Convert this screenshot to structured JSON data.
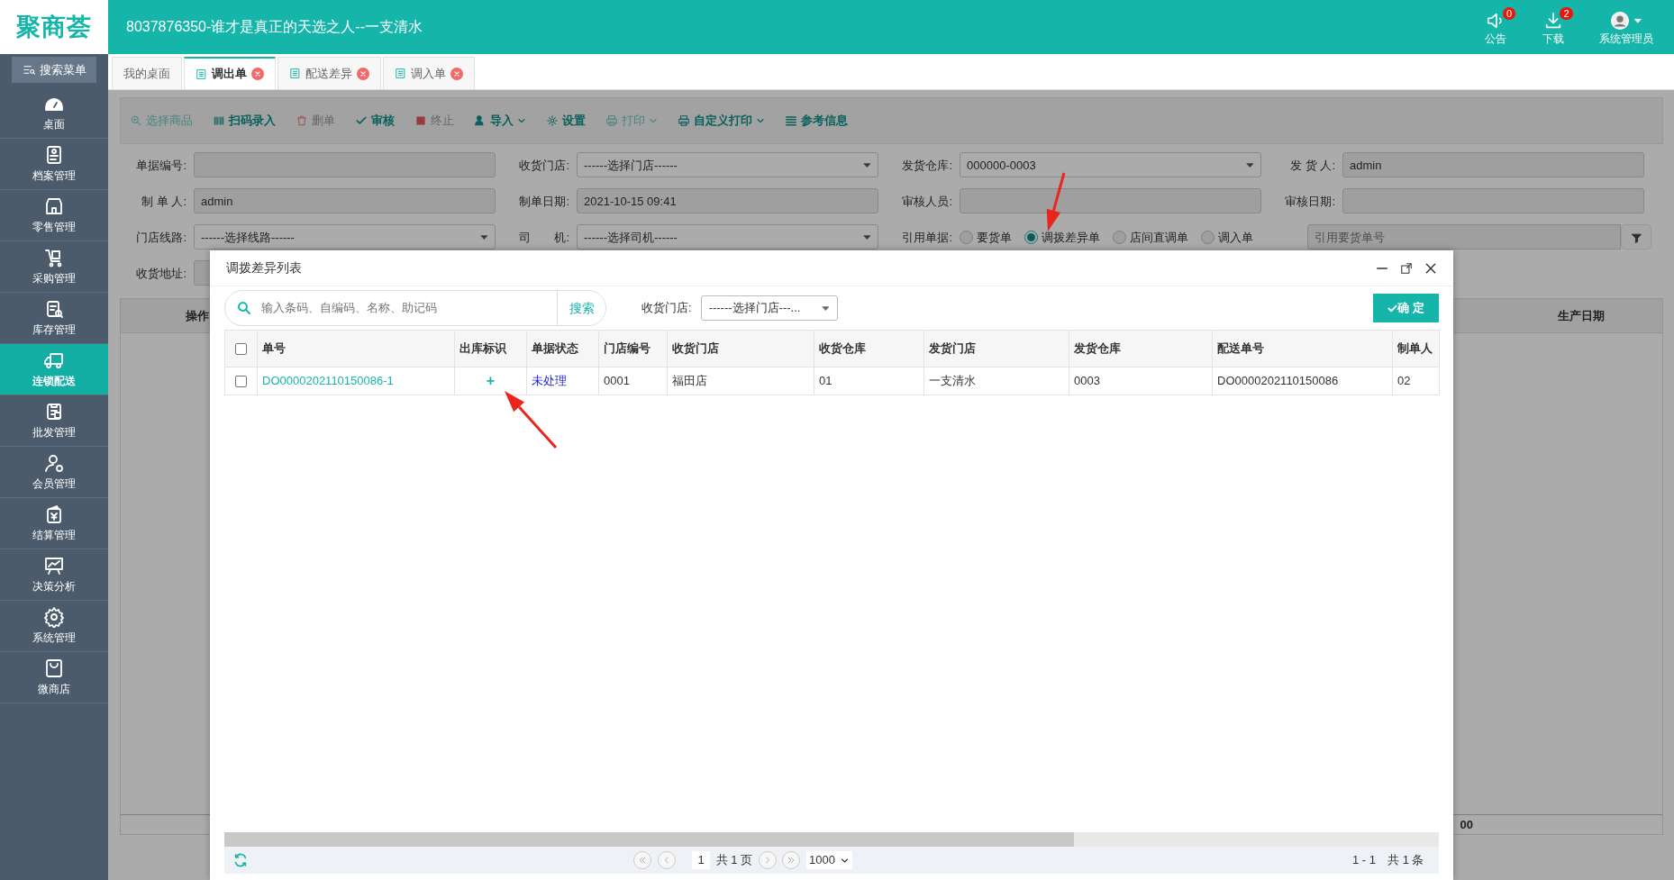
{
  "app": {
    "logo": "聚商荟",
    "title": "8037876350-谁才是真正的天选之人--一支清水"
  },
  "header_actions": [
    {
      "label": "公告",
      "badge": "0"
    },
    {
      "label": "下载",
      "badge": "2"
    },
    {
      "label": "系统管理员"
    }
  ],
  "sidebar": {
    "search_button": "搜索菜单",
    "items": [
      {
        "label": "桌面",
        "selected": false
      },
      {
        "label": "档案管理",
        "selected": false
      },
      {
        "label": "零售管理",
        "selected": false
      },
      {
        "label": "采购管理",
        "selected": false
      },
      {
        "label": "库存管理",
        "selected": false
      },
      {
        "label": "连锁配送",
        "selected": true
      },
      {
        "label": "批发管理",
        "selected": false
      },
      {
        "label": "会员管理",
        "selected": false
      },
      {
        "label": "结算管理",
        "selected": false
      },
      {
        "label": "决策分析",
        "selected": false
      },
      {
        "label": "系统管理",
        "selected": false
      },
      {
        "label": "微商店",
        "selected": false
      }
    ]
  },
  "tabs": [
    {
      "label": "我的桌面",
      "selected": false,
      "closable": false
    },
    {
      "label": "调出单",
      "selected": true,
      "closable": true
    },
    {
      "label": "配送差异",
      "selected": false,
      "closable": true
    },
    {
      "label": "调入单",
      "selected": false,
      "closable": true
    }
  ],
  "toolbar": [
    {
      "label": "选择商品",
      "kind": "search",
      "disabled": true,
      "dropdown": false
    },
    {
      "label": "扫码录入",
      "kind": "barcode",
      "disabled": false,
      "dropdown": false
    },
    {
      "label": "删单",
      "kind": "trash",
      "disabled": true,
      "dropdown": false
    },
    {
      "label": "审核",
      "kind": "check",
      "disabled": false,
      "dropdown": false
    },
    {
      "label": "终止",
      "kind": "stop",
      "disabled": true,
      "dropdown": false
    },
    {
      "label": "导入",
      "kind": "import",
      "disabled": false,
      "dropdown": true
    },
    {
      "label": "设置",
      "kind": "gear",
      "disabled": false,
      "dropdown": false
    },
    {
      "label": "打印",
      "kind": "print",
      "disabled": true,
      "dropdown": true
    },
    {
      "label": "自定义打印",
      "kind": "print",
      "disabled": false,
      "dropdown": true
    },
    {
      "label": "参考信息",
      "kind": "list",
      "disabled": false,
      "dropdown": false
    }
  ],
  "form": {
    "rows": [
      [
        {
          "label": "单据编号:",
          "kind": "input"
        },
        {
          "label": "收货门店:",
          "kind": "select",
          "value": "------选择门店------"
        },
        {
          "label": "发货仓库:",
          "kind": "select",
          "value": "000000-0003"
        },
        {
          "label": "发 货 人:",
          "kind": "input",
          "value": "admin"
        }
      ],
      [
        {
          "label": "制 单 人:",
          "kind": "input",
          "value": "admin"
        },
        {
          "label": "制单日期:",
          "kind": "input",
          "value": "2021-10-15 09:41"
        },
        {
          "label": "审核人员:",
          "kind": "input"
        },
        {
          "label": "审核日期:",
          "kind": "input"
        }
      ],
      [
        {
          "label": "门店线路:",
          "kind": "select",
          "value": "------选择线路------"
        },
        {
          "label": "司　　机:",
          "kind": "select",
          "value": "------选择司机------"
        }
      ],
      [
        {
          "label": "收货地址:",
          "kind": "input"
        }
      ]
    ],
    "reference": {
      "label": "引用单据:",
      "options": [
        {
          "label": "要货单",
          "selected": false
        },
        {
          "label": "调拨差异单",
          "selected": true
        },
        {
          "label": "店间直调单",
          "selected": false
        },
        {
          "label": "调入单",
          "selected": false
        }
      ],
      "placeholder": "引用要货单号"
    }
  },
  "background_table": {
    "columns": [
      "操作",
      "生产日期"
    ],
    "footer_cell": "00"
  },
  "dialog": {
    "title": "调拨差异列表",
    "search": {
      "placeholder": "输入条码、自编码、名称、助记码",
      "button": "搜索"
    },
    "store_filter": {
      "label": "收货门店:",
      "value": "------选择门店---..."
    },
    "confirm_button": "确 定",
    "table": {
      "columns": [
        "单号",
        "出库标识",
        "单据状态",
        "门店编号",
        "收货门店",
        "收货仓库",
        "发货门店",
        "发货仓库",
        "配送单号",
        "制单人"
      ],
      "header_checked": false,
      "rows": [
        {
          "checked": false,
          "cells": [
            "DO0000202110150086-1",
            "+",
            "未处理",
            "0001",
            "福田店",
            "01",
            "一支清水",
            "0003",
            "DO0000202110150086",
            "02"
          ]
        }
      ]
    },
    "pager": {
      "page": "1",
      "total_pages": "共 1 页",
      "page_size": "1000",
      "range": "1 - 1",
      "total": "共 1 条"
    }
  }
}
